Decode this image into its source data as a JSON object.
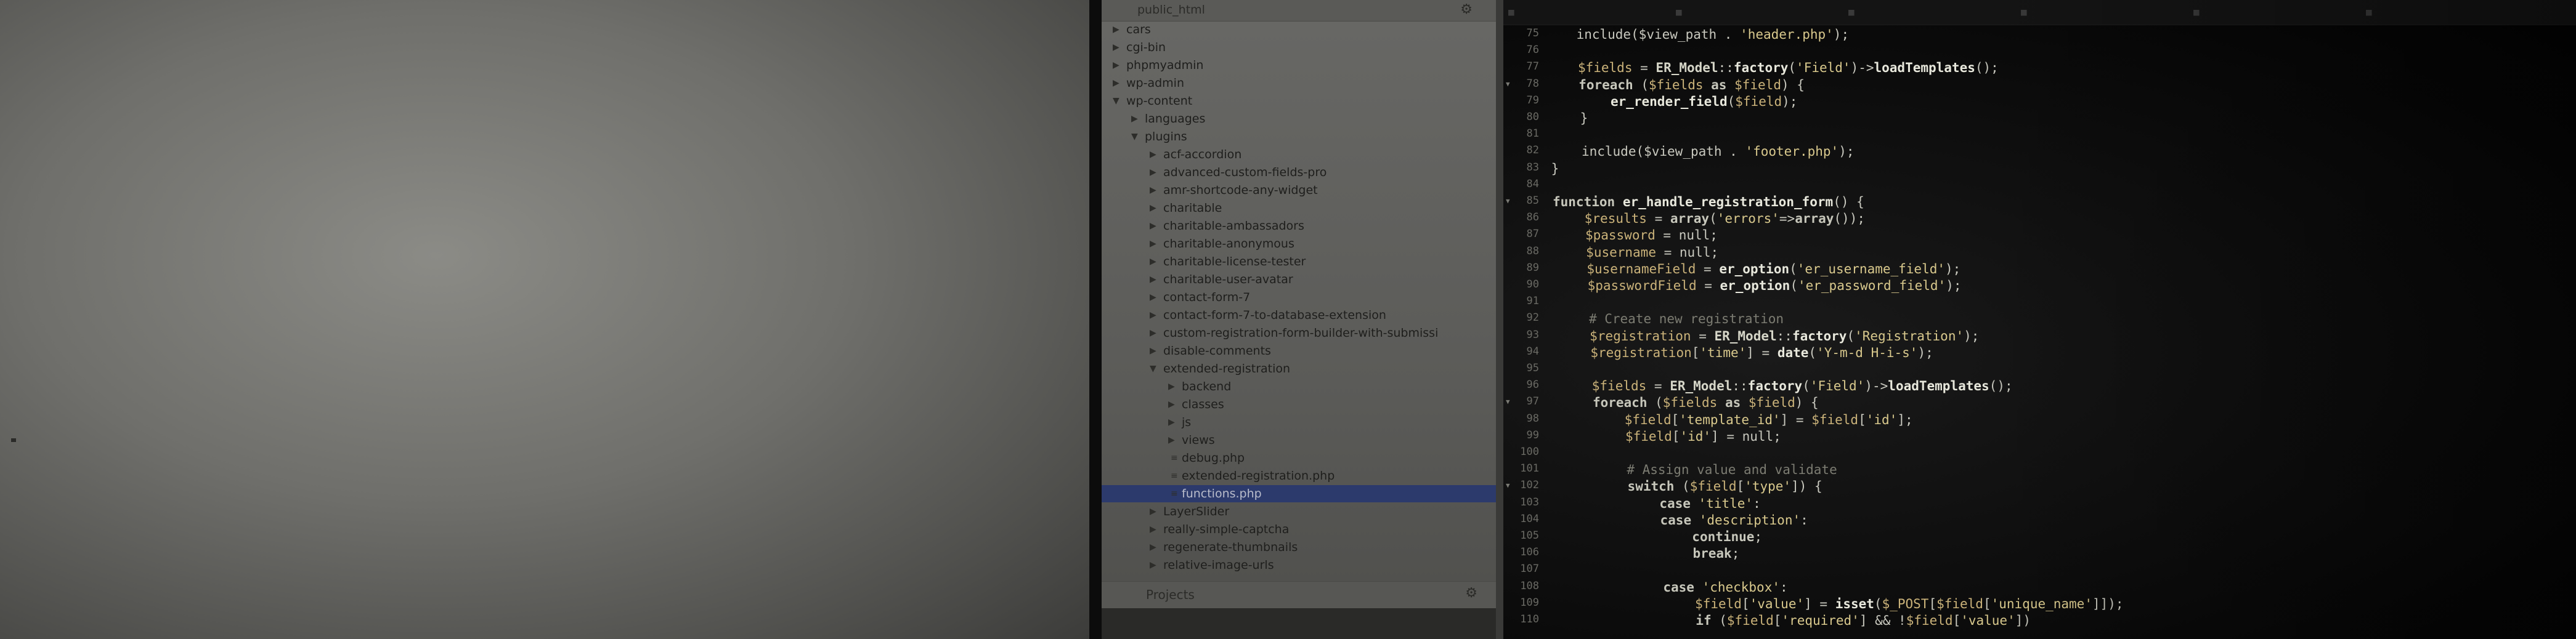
{
  "tree": {
    "root_label": "public_html",
    "items": [
      {
        "label": "cars",
        "depth": 0,
        "arrow": "▶"
      },
      {
        "label": "cgi-bin",
        "depth": 0,
        "arrow": "▶"
      },
      {
        "label": "phpmyadmin",
        "depth": 0,
        "arrow": "▶"
      },
      {
        "label": "wp-admin",
        "depth": 0,
        "arrow": "▶"
      },
      {
        "label": "wp-content",
        "depth": 0,
        "arrow": "▼"
      },
      {
        "label": "languages",
        "depth": 1,
        "arrow": "▶"
      },
      {
        "label": "plugins",
        "depth": 1,
        "arrow": "▼"
      },
      {
        "label": "acf-accordion",
        "depth": 2,
        "arrow": "▶"
      },
      {
        "label": "advanced-custom-fields-pro",
        "depth": 2,
        "arrow": "▶"
      },
      {
        "label": "amr-shortcode-any-widget",
        "depth": 2,
        "arrow": "▶"
      },
      {
        "label": "charitable",
        "depth": 2,
        "arrow": "▶"
      },
      {
        "label": "charitable-ambassadors",
        "depth": 2,
        "arrow": "▶"
      },
      {
        "label": "charitable-anonymous",
        "depth": 2,
        "arrow": "▶"
      },
      {
        "label": "charitable-license-tester",
        "depth": 2,
        "arrow": "▶"
      },
      {
        "label": "charitable-user-avatar",
        "depth": 2,
        "arrow": "▶"
      },
      {
        "label": "contact-form-7",
        "depth": 2,
        "arrow": "▶"
      },
      {
        "label": "contact-form-7-to-database-extension",
        "depth": 2,
        "arrow": "▶"
      },
      {
        "label": "custom-registration-form-builder-with-submissi",
        "depth": 2,
        "arrow": "▶"
      },
      {
        "label": "disable-comments",
        "depth": 2,
        "arrow": "▶"
      },
      {
        "label": "extended-registration",
        "depth": 2,
        "arrow": "▼"
      },
      {
        "label": "backend",
        "depth": 3,
        "arrow": "▶"
      },
      {
        "label": "classes",
        "depth": 3,
        "arrow": "▶"
      },
      {
        "label": "js",
        "depth": 3,
        "arrow": "▶"
      },
      {
        "label": "views",
        "depth": 3,
        "arrow": "▶"
      },
      {
        "label": "debug.php",
        "depth": 3,
        "arrow": ""
      },
      {
        "label": "extended-registration.php",
        "depth": 3,
        "arrow": ""
      },
      {
        "label": "functions.php",
        "depth": 3,
        "arrow": "",
        "selected": true
      },
      {
        "label": "LayerSlider",
        "depth": 2,
        "arrow": "▶"
      },
      {
        "label": "really-simple-captcha",
        "depth": 2,
        "arrow": "▶"
      },
      {
        "label": "regenerate-thumbnails",
        "depth": 2,
        "arrow": "▶"
      },
      {
        "label": "relative-image-urls",
        "depth": 2,
        "arrow": "▶"
      }
    ],
    "footer_label": "Projects"
  },
  "editor": {
    "lines": [
      {
        "n": "75",
        "html": "    include($view_path . <span class=\"str\">'header.php'</span>);"
      },
      {
        "n": "76",
        "html": ""
      },
      {
        "n": "77",
        "html": "    <span class=\"var\">$fields</span> = <span class=\"cls\">ER_Model</span>::<span class=\"fn\">factory</span>(<span class=\"str\">'Field'</span>)-><span class=\"fn\">loadTemplates</span>();"
      },
      {
        "n": "78",
        "html": "    <span class=\"kw\">foreach</span> (<span class=\"var\">$fields</span> <span class=\"kw\">as</span> <span class=\"var\">$field</span>) {",
        "fold": true
      },
      {
        "n": "79",
        "html": "        <span class=\"fn\">er_render_field</span>(<span class=\"var\">$field</span>);"
      },
      {
        "n": "80",
        "html": "    }"
      },
      {
        "n": "81",
        "html": ""
      },
      {
        "n": "82",
        "html": "    include($view_path . <span class=\"str\">'footer.php'</span>);"
      },
      {
        "n": "83",
        "html": "}"
      },
      {
        "n": "84",
        "html": ""
      },
      {
        "n": "85",
        "html": "<span class=\"kw\">function</span> <span class=\"fn\">er_handle_registration_form</span>() {",
        "fold": true
      },
      {
        "n": "86",
        "html": "    <span class=\"var\">$results</span> = <span class=\"kw\">array</span>(<span class=\"str\">'errors'</span>=><span class=\"kw\">array</span>());"
      },
      {
        "n": "87",
        "html": "    <span class=\"var\">$password</span> = null;"
      },
      {
        "n": "88",
        "html": "    <span class=\"var\">$username</span> = null;"
      },
      {
        "n": "89",
        "html": "    <span class=\"var\">$usernameField</span> = <span class=\"fn\">er_option</span>(<span class=\"str\">'er_username_field'</span>);"
      },
      {
        "n": "90",
        "html": "    <span class=\"var\">$passwordField</span> = <span class=\"fn\">er_option</span>(<span class=\"str\">'er_password_field'</span>);"
      },
      {
        "n": "91",
        "html": ""
      },
      {
        "n": "92",
        "html": "    <span class=\"cmt\"># Create new registration</span>"
      },
      {
        "n": "93",
        "html": "    <span class=\"var\">$registration</span> = <span class=\"cls\">ER_Model</span>::<span class=\"fn\">factory</span>(<span class=\"str\">'Registration'</span>);"
      },
      {
        "n": "94",
        "html": "    <span class=\"var\">$registration</span>[<span class=\"str\">'time'</span>] = <span class=\"fn\">date</span>(<span class=\"str\">'Y-m-d H-i-s'</span>);"
      },
      {
        "n": "95",
        "html": ""
      },
      {
        "n": "96",
        "html": "    <span class=\"var\">$fields</span> = <span class=\"cls\">ER_Model</span>::<span class=\"fn\">factory</span>(<span class=\"str\">'Field'</span>)-><span class=\"fn\">loadTemplates</span>();"
      },
      {
        "n": "97",
        "html": "    <span class=\"kw\">foreach</span> (<span class=\"var\">$fields</span> <span class=\"kw\">as</span> <span class=\"var\">$field</span>) {",
        "fold": true
      },
      {
        "n": "98",
        "html": "        <span class=\"var\">$field</span>[<span class=\"str\">'template_id'</span>] = <span class=\"var\">$field</span>[<span class=\"str\">'id'</span>];"
      },
      {
        "n": "99",
        "html": "        <span class=\"var\">$field</span>[<span class=\"str\">'id'</span>] = null;"
      },
      {
        "n": "100",
        "html": ""
      },
      {
        "n": "101",
        "html": "        <span class=\"cmt\"># Assign value and validate</span>"
      },
      {
        "n": "102",
        "html": "        <span class=\"kw\">switch</span> (<span class=\"var\">$field</span>[<span class=\"str\">'type'</span>]) {",
        "fold": true
      },
      {
        "n": "103",
        "html": "            <span class=\"kw\">case</span> <span class=\"str\">'title'</span>:"
      },
      {
        "n": "104",
        "html": "            <span class=\"kw\">case</span> <span class=\"str\">'description'</span>:"
      },
      {
        "n": "105",
        "html": "                <span class=\"kw\">continue</span>;"
      },
      {
        "n": "106",
        "html": "                <span class=\"kw\">break</span>;"
      },
      {
        "n": "107",
        "html": ""
      },
      {
        "n": "108",
        "html": "            <span class=\"kw\">case</span> <span class=\"str\">'checkbox'</span>:"
      },
      {
        "n": "109",
        "html": "                <span class=\"var\">$field</span>[<span class=\"str\">'value'</span>] = <span class=\"fn\">isset</span>(<span class=\"var\">$_POST</span>[<span class=\"var\">$field</span>[<span class=\"str\">'unique_name'</span>]]);"
      },
      {
        "n": "110",
        "html": "                <span class=\"kw\">if</span> (<span class=\"var\">$field</span>[<span class=\"str\">'required'</span>] && !<span class=\"var\">$field</span>[<span class=\"str\">'value'</span>])"
      }
    ]
  }
}
